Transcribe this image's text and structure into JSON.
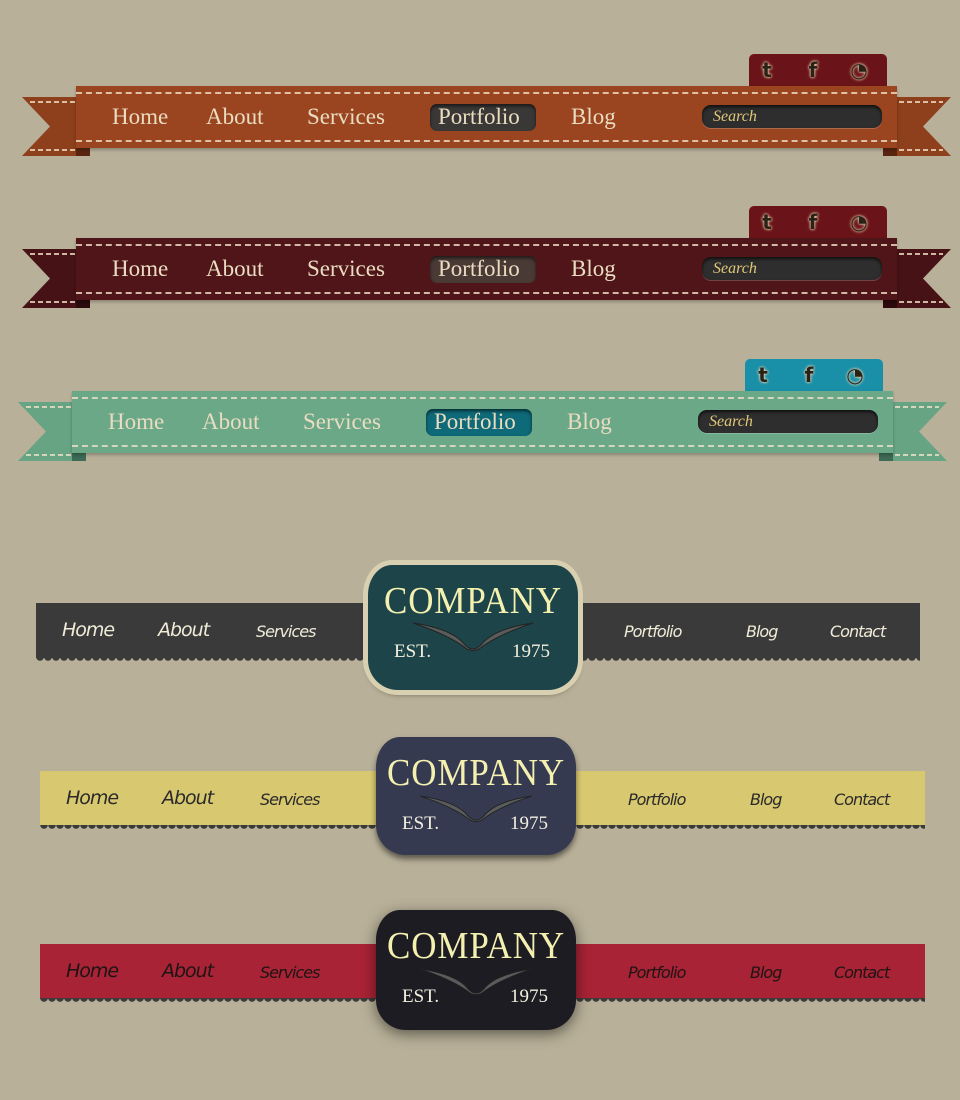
{
  "ribbon_navs": [
    {
      "nav": [
        "Home",
        "About",
        "Services",
        "Portfolio",
        "Blog"
      ],
      "active": "Portfolio",
      "search_placeholder": "Search",
      "social": [
        "twitter-icon",
        "facebook-icon",
        "rss-icon"
      ],
      "colors": {
        "bar": "#9a4520",
        "tail": "#8e3f1c",
        "fold": "#5a2410",
        "social": "#6a1419",
        "pill": "#3a3836"
      }
    },
    {
      "nav": [
        "Home",
        "About",
        "Services",
        "Portfolio",
        "Blog"
      ],
      "active": "Portfolio",
      "search_placeholder": "Search",
      "social": [
        "twitter-icon",
        "facebook-icon",
        "rss-icon"
      ],
      "colors": {
        "bar": "#4f1519",
        "tail": "#461216",
        "fold": "#2a0a0c",
        "social": "#6a1419",
        "pill": "#4a3a36"
      }
    },
    {
      "nav": [
        "Home",
        "About",
        "Services",
        "Portfolio",
        "Blog"
      ],
      "active": "Portfolio",
      "search_placeholder": "Search",
      "social": [
        "twitter-icon",
        "facebook-icon",
        "rss-icon"
      ],
      "colors": {
        "bar": "#6aa888",
        "tail": "#66a484",
        "fold": "#3e6a56",
        "social": "#1a8fa8",
        "pill": "#0e6a78"
      }
    }
  ],
  "badge_navs": [
    {
      "left_nav": [
        "Home",
        "About",
        "Services"
      ],
      "right_nav": [
        "Portfolio",
        "Blog",
        "Contact"
      ],
      "badge": {
        "title": "COMPANY",
        "est": "EST.",
        "year": "1975"
      },
      "colors": {
        "band": "#3a3a3a",
        "text": "#f0ecd8",
        "badge": "#1d4448",
        "badge_border": "#d8d0b0"
      }
    },
    {
      "left_nav": [
        "Home",
        "About",
        "Services"
      ],
      "right_nav": [
        "Portfolio",
        "Blog",
        "Contact"
      ],
      "badge": {
        "title": "COMPANY",
        "est": "EST.",
        "year": "1975"
      },
      "colors": {
        "band": "#d8c870",
        "text": "#2a2a2a",
        "badge": "#353a50",
        "badge_border": "#353a50"
      }
    },
    {
      "left_nav": [
        "Home",
        "About",
        "Services"
      ],
      "right_nav": [
        "Portfolio",
        "Blog",
        "Contact"
      ],
      "badge": {
        "title": "COMPANY",
        "est": "EST.",
        "year": "1975"
      },
      "colors": {
        "band": "#a82335",
        "text": "#1e1414",
        "badge": "#1c1c22",
        "badge_border": "#1c1c22"
      }
    }
  ]
}
